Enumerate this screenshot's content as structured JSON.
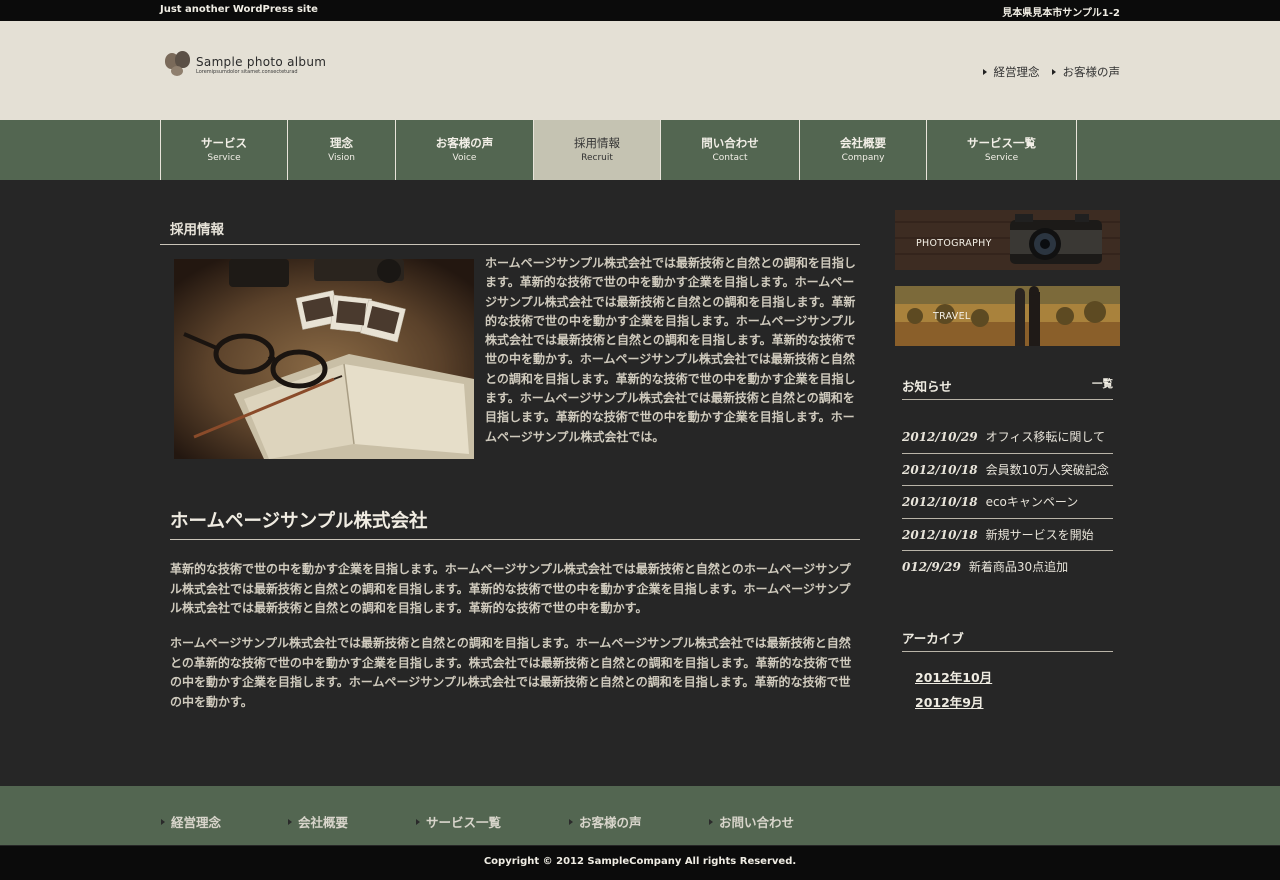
{
  "topbar": {
    "tagline": "Just another WordPress site",
    "address": "見本県見本市サンプル1-2"
  },
  "logo": {
    "title": "Sample photo album",
    "subtitle": "Loremipsumdolor sitamet.consecteturad"
  },
  "header_links": [
    "経営理念",
    "お客様の声"
  ],
  "nav": [
    {
      "jp": "サービス",
      "en": "Service"
    },
    {
      "jp": "理念",
      "en": "Vision"
    },
    {
      "jp": "お客様の声",
      "en": "Voice"
    },
    {
      "jp": "採用情報",
      "en": "Recruit"
    },
    {
      "jp": "問い合わせ",
      "en": "Contact"
    },
    {
      "jp": "会社概要",
      "en": "Company"
    },
    {
      "jp": "サービス一覧",
      "en": "Service"
    }
  ],
  "nav_active": "採用情報",
  "main": {
    "page_title": "採用情報",
    "intro": "ホームページサンプル株式会社では最新技術と自然との調和を目指します。革新的な技術で世の中を動かす企業を目指します。ホームページサンプル株式会社では最新技術と自然との調和を目指します。革新的な技術で世の中を動かす企業を目指します。ホームページサンプル株式会社では最新技術と自然との調和を目指します。革新的な技術で世の中を動かす。ホームページサンプル株式会社では最新技術と自然との調和を目指します。革新的な技術で世の中を動かす企業を目指します。ホームページサンプル株式会社では最新技術と自然との調和を目指します。革新的な技術で世の中を動かす企業を目指します。ホームページサンプル株式会社では。",
    "company_title": "ホームページサンプル株式会社",
    "para1": "革新的な技術で世の中を動かす企業を目指します。ホームページサンプル株式会社では最新技術と自然とのホームページサンプル株式会社では最新技術と自然との調和を目指します。革新的な技術で世の中を動かす企業を目指します。ホームページサンプル株式会社では最新技術と自然との調和を目指します。革新的な技術で世の中を動かす。",
    "para2": "ホームページサンプル株式会社では最新技術と自然との調和を目指します。ホームページサンプル株式会社では最新技術と自然との革新的な技術で世の中を動かす企業を目指します。株式会社では最新技術と自然との調和を目指します。革新的な技術で世の中を動かす企業を目指します。ホームページサンプル株式会社では最新技術と自然との調和を目指します。革新的な技術で世の中を動かす。"
  },
  "sidebar": {
    "banners": [
      "PHOTOGRAPHY",
      "TRAVEL"
    ],
    "news_title": "お知らせ",
    "news_all": "一覧",
    "news": [
      {
        "date": "2012/10/29",
        "text": "オフィス移転に関して"
      },
      {
        "date": "2012/10/18",
        "text": "会員数10万人突破記念"
      },
      {
        "date": "2012/10/18",
        "text": "ecoキャンペーン"
      },
      {
        "date": "2012/10/18",
        "text": "新規サービスを開始"
      },
      {
        "date": "012/9/29",
        "text": "新着商品30点追加"
      }
    ],
    "archive_title": "アーカイブ",
    "archives": [
      "2012年10月",
      "2012年9月"
    ]
  },
  "footer_nav": [
    "経営理念",
    "会社概要",
    "サービス一覧",
    "お客様の声",
    "お問い合わせ"
  ],
  "copyright": "Copyright © 2012 SampleCompany All rights Reserved.",
  "colors": {
    "nav_green": "#536651",
    "header_beige": "#e4e0d5",
    "body_dark": "#262626",
    "nav_active": "#c5c3b2"
  }
}
